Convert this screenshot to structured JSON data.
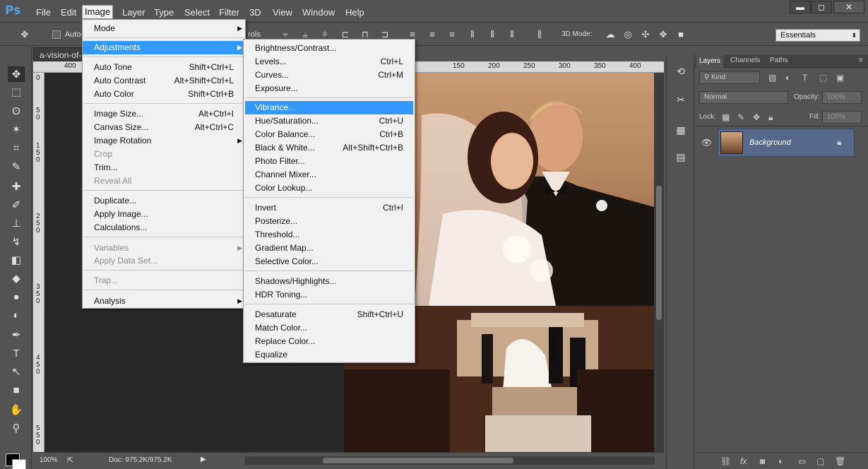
{
  "app": {
    "logo": "Ps"
  },
  "menubar": [
    "File",
    "Edit",
    "Image",
    "Layer",
    "Type",
    "Select",
    "Filter",
    "3D",
    "View",
    "Window",
    "Help"
  ],
  "window_controls": {
    "minimize": "▬",
    "maximize": "◻",
    "close": "✕"
  },
  "options_bar": {
    "auto_select_label": "Auto-",
    "controls_label": "rols",
    "mode_3d": "3D Mode:",
    "workspace": "Essentials"
  },
  "document": {
    "tab": "a-vision-of-",
    "zoom": "100%",
    "doc_size": "Doc: 975.2K/975.2K",
    "ruler_h": [
      "400",
      "150",
      "200",
      "250",
      "300",
      "350",
      "400"
    ],
    "ruler_v": [
      "0",
      "5",
      "0",
      "1",
      "5",
      "0",
      "2",
      "5",
      "0",
      "3",
      "5",
      "0",
      "4",
      "5",
      "0",
      "5",
      "5",
      "0"
    ]
  },
  "image_menu": {
    "items": [
      {
        "label": "Mode",
        "shortcut": "",
        "submenu": true,
        "disabled": false
      },
      {
        "label": "Adjustments",
        "shortcut": "",
        "submenu": true,
        "disabled": false,
        "highlight": true
      },
      {
        "label": "Auto Tone",
        "shortcut": "Shift+Ctrl+L",
        "disabled": false
      },
      {
        "label": "Auto Contrast",
        "shortcut": "Alt+Shift+Ctrl+L",
        "disabled": false
      },
      {
        "label": "Auto Color",
        "shortcut": "Shift+Ctrl+B",
        "disabled": false
      },
      {
        "label": "Image Size...",
        "shortcut": "Alt+Ctrl+I",
        "disabled": false
      },
      {
        "label": "Canvas Size...",
        "shortcut": "Alt+Ctrl+C",
        "disabled": false
      },
      {
        "label": "Image Rotation",
        "shortcut": "",
        "submenu": true,
        "disabled": false
      },
      {
        "label": "Crop",
        "shortcut": "",
        "disabled": true
      },
      {
        "label": "Trim...",
        "shortcut": "",
        "disabled": false
      },
      {
        "label": "Reveal All",
        "shortcut": "",
        "disabled": true
      },
      {
        "label": "Duplicate...",
        "shortcut": "",
        "disabled": false
      },
      {
        "label": "Apply Image...",
        "shortcut": "",
        "disabled": false
      },
      {
        "label": "Calculations...",
        "shortcut": "",
        "disabled": false
      },
      {
        "label": "Variables",
        "shortcut": "",
        "submenu": true,
        "disabled": true
      },
      {
        "label": "Apply Data Set...",
        "shortcut": "",
        "disabled": true
      },
      {
        "label": "Trap...",
        "shortcut": "",
        "disabled": true
      },
      {
        "label": "Analysis",
        "shortcut": "",
        "submenu": true,
        "disabled": false
      }
    ]
  },
  "adjustments_menu": {
    "items": [
      {
        "label": "Brightness/Contrast...",
        "shortcut": ""
      },
      {
        "label": "Levels...",
        "shortcut": "Ctrl+L"
      },
      {
        "label": "Curves...",
        "shortcut": "Ctrl+M"
      },
      {
        "label": "Exposure...",
        "shortcut": ""
      },
      {
        "label": "Vibrance...",
        "shortcut": "",
        "highlight": true
      },
      {
        "label": "Hue/Saturation...",
        "shortcut": "Ctrl+U"
      },
      {
        "label": "Color Balance...",
        "shortcut": "Ctrl+B"
      },
      {
        "label": "Black & White...",
        "shortcut": "Alt+Shift+Ctrl+B"
      },
      {
        "label": "Photo Filter...",
        "shortcut": ""
      },
      {
        "label": "Channel Mixer...",
        "shortcut": ""
      },
      {
        "label": "Color Lookup...",
        "shortcut": ""
      },
      {
        "label": "Invert",
        "shortcut": "Ctrl+I"
      },
      {
        "label": "Posterize...",
        "shortcut": ""
      },
      {
        "label": "Threshold...",
        "shortcut": ""
      },
      {
        "label": "Gradient Map...",
        "shortcut": ""
      },
      {
        "label": "Selective Color...",
        "shortcut": ""
      },
      {
        "label": "Shadows/Highlights...",
        "shortcut": ""
      },
      {
        "label": "HDR Toning...",
        "shortcut": ""
      },
      {
        "label": "Desaturate",
        "shortcut": "Shift+Ctrl+U"
      },
      {
        "label": "Match Color...",
        "shortcut": ""
      },
      {
        "label": "Replace Color...",
        "shortcut": ""
      },
      {
        "label": "Equalize",
        "shortcut": ""
      }
    ]
  },
  "layers_panel": {
    "tabs": [
      "Layers",
      "Channels",
      "Paths"
    ],
    "kind": "Kind",
    "blend_mode": "Normal",
    "opacity_label": "Opacity:",
    "opacity_value": "100%",
    "lock_label": "Lock:",
    "fill_label": "Fill:",
    "fill_value": "100%",
    "layer_name": "Background"
  },
  "colors": {
    "highlight": "#3399ff",
    "panel_bg": "#535353",
    "layer_selected": "#56698a"
  }
}
